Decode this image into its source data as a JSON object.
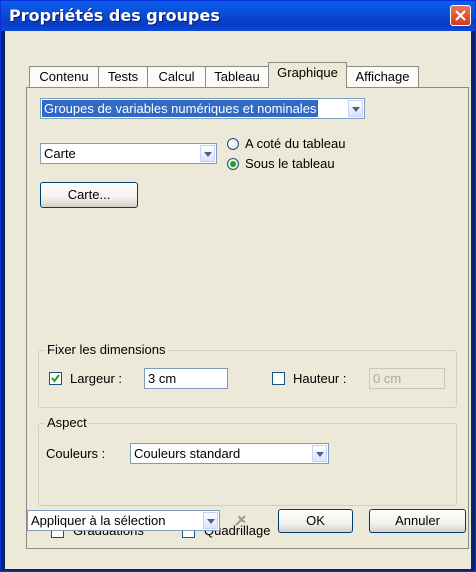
{
  "window": {
    "title": "Propriétés des groupes"
  },
  "tabs": [
    {
      "label": "Contenu"
    },
    {
      "label": "Tests"
    },
    {
      "label": "Calcul"
    },
    {
      "label": "Tableau"
    },
    {
      "label": "Graphique",
      "active": true
    },
    {
      "label": "Affichage"
    }
  ],
  "graphique": {
    "group_type_select": "Groupes de variables numériques et nominales",
    "chart_type_select": "Carte",
    "position_options": [
      {
        "label": "A coté du tableau",
        "selected": false
      },
      {
        "label": "Sous le tableau",
        "selected": true
      }
    ],
    "carte_button": "Carte...",
    "dimensions": {
      "legend": "Fixer les dimensions",
      "width_label": "Largeur :",
      "width_checked": true,
      "width_value": "3 cm",
      "height_label": "Hauteur :",
      "height_checked": false,
      "height_value": "0 cm"
    },
    "aspect": {
      "legend": "Aspect",
      "colors_label": "Couleurs :",
      "colors_value": "Couleurs standard"
    },
    "graduations_label": "Graduations",
    "graduations_checked": false,
    "grid_label": "Quadrillage",
    "grid_checked": false
  },
  "footer": {
    "apply_select": "Appliquer à la sélection",
    "ok_label": "OK",
    "cancel_label": "Annuler"
  },
  "colors": {
    "titlebar": "#0a4fd6",
    "dialog_bg": "#ece9d8",
    "selection": "#316ac5",
    "radio_dot": "#21a121"
  }
}
